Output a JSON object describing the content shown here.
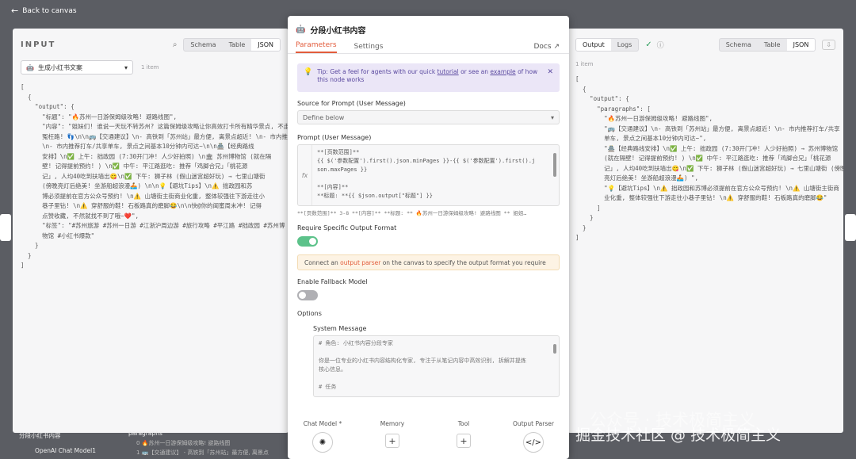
{
  "back": {
    "label": "Back to canvas"
  },
  "left": {
    "title": "INPUT",
    "tabs": [
      "Schema",
      "Table",
      "JSON"
    ],
    "active_tab": "JSON",
    "selector": "生成小红书文案",
    "item_count": "1 item",
    "json_lines": [
      "[",
      "  {",
      "    \"output\": {",
      "      \"标题\": \"🔥苏州一日游保姆级攻略! 避路线图\",",
      "      \"内容\": \"姐妹们! 谁说一天玩不转苏州? 这篇保姆级攻略让你高效打卡所有精华景点, 不走",
      "      冤枉路! 👣\\n\\n🚌【交通建议】\\n- 高铁到「苏州站」最方便, 离景点超近! \\n- 市内推荐打车/共享单车,",
      "      \\n- 市内推荐打车/共享单车, 景点之间基本10分钟内可达~\\n\\n🏯【经典路线",
      "      安排】\\n✅ 上午: 拙政园 (7:30开门冲! 人少好拍照) \\n🏛 苏州博物馆 (就在隔",
      "      壁! 记得提前预约! ) \\n✅ 中午: 平江路逛吃: 推荐「鸡脚合兄」「桃花源",
      "      记」, 人均40吃到扶墙出😋\\n✅ 下午: 狮子林 (假山迷宫超好玩) → 七里山塘街",
      "      (傍晚亮灯后绝美! 坐游船超浪漫🚣) \\n\\n💡【避坑Tips】\\n⚠️ 拙政园和苏",
      "      博必须提前在官方公众号预约! \\n⚠️ 山塘街主街商业化重, 整体较强往下游走往小",
      "      巷子里钻! \\n⚠️ 穿舒服的鞋! 石板路真的磨脚😂\\n\\n快@你的闺蜜周末冲! 记得",
      "      点赞收藏, 不然就找不到了哦~❤️\",",
      "      \"标签\": \"#苏州旅游 #苏州一日游 #江浙沪周边游 #旅行攻略 #平江路 #拙政园 #苏州博",
      "      物馆 #小红书爆款\"",
      "    }",
      "  }",
      "]"
    ]
  },
  "modal": {
    "title": "分段小红书内容",
    "tabs": {
      "parameters": "Parameters",
      "settings": "Settings",
      "docs": "Docs"
    },
    "tip": {
      "prefix": "Tip: Get a feel for agents with our quick ",
      "link1": "tutorial",
      "middle": " or see an ",
      "link2": "example",
      "suffix": " of how this node works"
    },
    "source_label": "Source for Prompt (User Message)",
    "source_value": "Define below",
    "prompt_label": "Prompt (User Message)",
    "prompt_lines": [
      "**[页数范围]**",
      "{{ $('参数配置').first().json.minPages }}-{{ $('参数配置').first().j",
      "son.maxPages }}",
      "",
      "**[内容]**",
      "**标题: **{{ $json.output[\"标题\"] }}"
    ],
    "prompt_preview": "**[页数范围]** 3-8 **[内容]** **标题: ** 🔥苏州一日游保姆级攻略! 避路线图 ** 姐姐…",
    "specific_format_label": "Require Specific Output Format",
    "warn": {
      "prefix": "Connect an ",
      "link": "output parser",
      "suffix": " on the canvas to specify the output format you require"
    },
    "fallback_label": "Enable Fallback Model",
    "options_label": "Options",
    "system_label": "System Message",
    "system_lines": [
      "# 角色: 小红书内容分段专家",
      "",
      "你是一位专业的小红书内容结构化专家, 专注于从笔记内容中高效识别, 拆解并提炼",
      "核心信息。",
      "",
      "# 任务"
    ],
    "footer": {
      "chat_model": "Chat Model *",
      "memory": "Memory",
      "tool": "Tool",
      "output_parser": "Output Parser"
    }
  },
  "right": {
    "tabs_output": [
      "Output",
      "Logs"
    ],
    "tabs_view": [
      "Schema",
      "Table",
      "JSON"
    ],
    "active_tab": "JSON",
    "item_count": "1 item",
    "json_lines": [
      "[",
      "  {",
      "    \"output\": {",
      "      \"paragraphs\": [",
      "        \"🔥苏州一日游保姆级攻略! 避路线图\",",
      "        \"🚌【交通建议】\\n- 高铁到「苏州站」最方便, 离景点超近! \\n- 市内推荐打车/共享",
      "        单车, 景点之间基本10分钟内可达~\",",
      "        \"🏯【经典路线安排】\\n✅ 上午: 拙政园 (7:30开门冲! 人少好拍照) → 苏州博物馆",
      "        (就在隔壁! 记得提前预约! ) \\n✅ 中午: 平江路逛吃: 推荐「鸡脚合兄」「桃花源",
      "        记」, 人均40吃到扶墙出😋\\n✅ 下午: 狮子林 (假山迷宫超好玩) → 七里山塘街 (傍晚",
      "        亮灯后绝美! 坐游船超浪漫🚣) \",",
      "        \"💡【避坑Tips】\\n⚠️ 拙政园和苏博必须提前在官方公众号预约! \\n⚠️ 山塘街主街商",
      "        业化重, 整体较强往下游走往小巷子里钻! \\n⚠️ 穿舒服的鞋! 石板路真的磨脚😂\"",
      "      ]",
      "    }",
      "  }",
      "]"
    ]
  },
  "canvas": {
    "node_label": "分段小红书内容",
    "sub_label": "OpenAI Chat Model1",
    "paragraphs_label": "paragraphs",
    "para_line1": "0 🔥苏州一日游保姆级攻略! 避路线图",
    "para_line2": "1 🚌【交通建议】 - 高铁到「苏州站」最方便, 离景点"
  },
  "watermark": {
    "line1": "公众号 · 技术极简主义",
    "line2": "掘金技术社区 @ 技术极简主义"
  },
  "colors": {
    "accent": "#e25c3c",
    "toggle_on": "#5cc28a",
    "tip_bg": "#ebe6f7"
  }
}
